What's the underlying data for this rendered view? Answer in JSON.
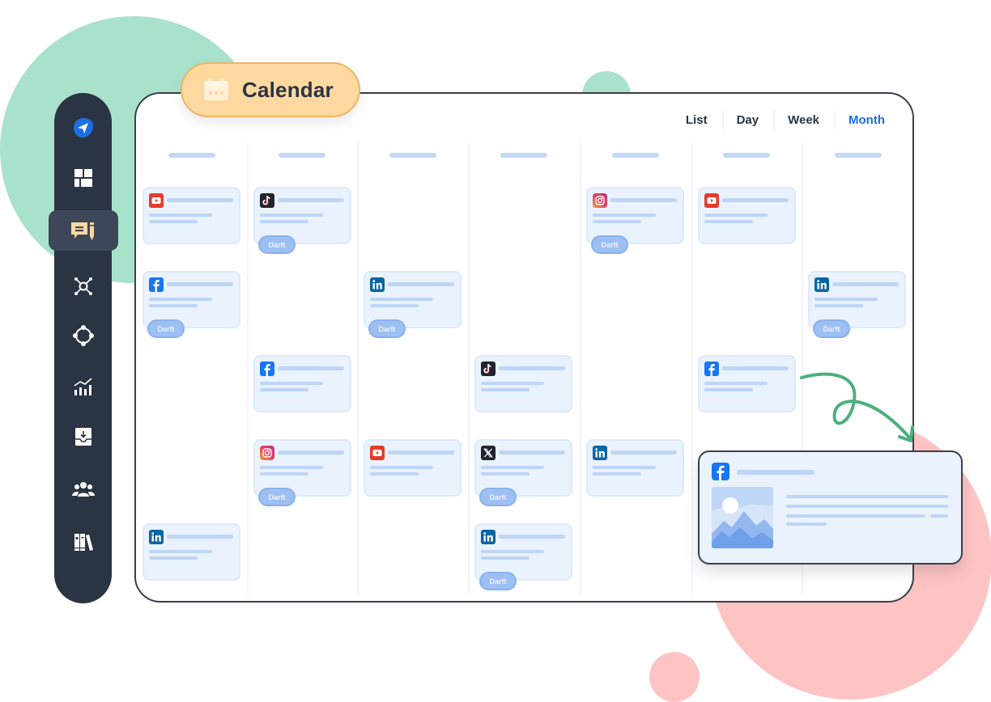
{
  "page": {
    "title": "Calendar"
  },
  "header": {
    "label": "Calendar",
    "icon": "calendar-icon"
  },
  "sidebar": {
    "items": [
      {
        "name": "send",
        "icon": "paper-plane-icon",
        "active": false
      },
      {
        "name": "dashboard",
        "icon": "dashboard-grid-icon",
        "active": false
      },
      {
        "name": "publish",
        "icon": "compose-post-icon",
        "active": true
      },
      {
        "name": "engage",
        "icon": "network-hub-icon",
        "active": false
      },
      {
        "name": "workflow",
        "icon": "connected-nodes-icon",
        "active": false
      },
      {
        "name": "analytics",
        "icon": "bar-chart-trend-icon",
        "active": false
      },
      {
        "name": "inbox",
        "icon": "inbox-download-icon",
        "active": false
      },
      {
        "name": "team",
        "icon": "team-users-icon",
        "active": false
      },
      {
        "name": "library",
        "icon": "library-books-icon",
        "active": false
      }
    ]
  },
  "view_tabs": {
    "items": [
      {
        "label": "List",
        "active": false
      },
      {
        "label": "Day",
        "active": false
      },
      {
        "label": "Week",
        "active": false
      },
      {
        "label": "Month",
        "active": true
      }
    ],
    "active_color": "#1C6FE0"
  },
  "calendar": {
    "columns": 7,
    "posts": [
      {
        "col": 0,
        "row": 0,
        "network": "youtube",
        "status": null
      },
      {
        "col": 0,
        "row": 1,
        "network": "facebook",
        "status": "Darft"
      },
      {
        "col": 0,
        "row": 4,
        "network": "linkedin",
        "status": null
      },
      {
        "col": 1,
        "row": 0,
        "network": "tiktok",
        "status": "Darft"
      },
      {
        "col": 1,
        "row": 2,
        "network": "facebook",
        "status": null
      },
      {
        "col": 1,
        "row": 3,
        "network": "instagram",
        "status": "Darft"
      },
      {
        "col": 2,
        "row": 1,
        "network": "linkedin",
        "status": "Darft"
      },
      {
        "col": 2,
        "row": 3,
        "network": "youtube",
        "status": null
      },
      {
        "col": 3,
        "row": 2,
        "network": "tiktok",
        "status": null
      },
      {
        "col": 3,
        "row": 3,
        "network": "x",
        "status": "Darft"
      },
      {
        "col": 3,
        "row": 4,
        "network": "linkedin",
        "status": "Darft"
      },
      {
        "col": 4,
        "row": 0,
        "network": "instagram",
        "status": "Darft"
      },
      {
        "col": 4,
        "row": 3,
        "network": "linkedin",
        "status": null
      },
      {
        "col": 5,
        "row": 0,
        "network": "youtube",
        "status": null
      },
      {
        "col": 5,
        "row": 2,
        "network": "facebook",
        "status": null
      },
      {
        "col": 6,
        "row": 1,
        "network": "linkedin",
        "status": "Darft"
      }
    ]
  },
  "preview_card": {
    "network": "facebook",
    "icon": "facebook-icon",
    "image": "landscape-image"
  },
  "colors": {
    "sidebar_bg": "#2B3442",
    "accent_blue": "#1C6FE0",
    "pill_bg": "#FDD9A0",
    "green_blob": "#A8E2CB",
    "pink_blob": "#FEC4C4",
    "card_bg": "#E9F2FD",
    "arrow_green": "#4CAF7D"
  }
}
